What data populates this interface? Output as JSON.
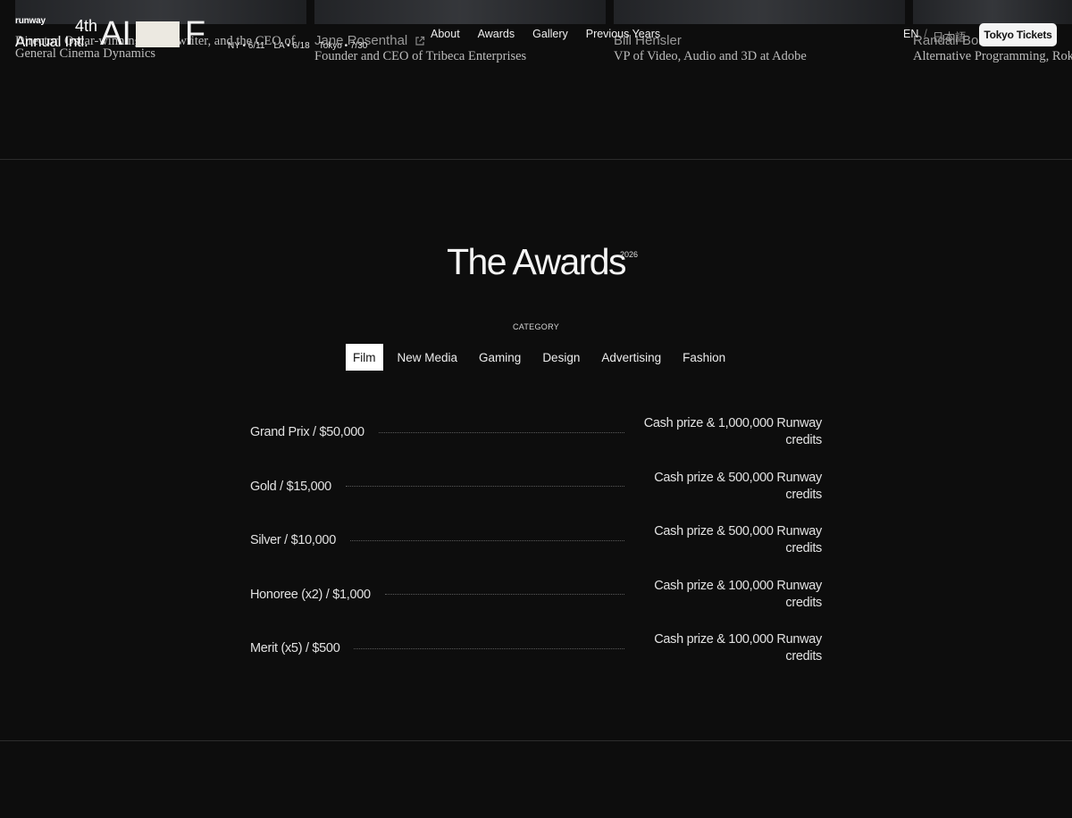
{
  "header": {
    "brand": "runway",
    "edition_line1": "4th",
    "edition_line2": "Annual Intl.",
    "logo": {
      "letters_left": "AI",
      "letters_right": "F"
    },
    "dates": [
      "NY • 6/11",
      "LA • 6/18",
      "Tokyo • 7/30"
    ],
    "nav": [
      "About",
      "Awards",
      "Gallery",
      "Previous Years"
    ],
    "lang": {
      "active": "EN",
      "separator": "/",
      "other": "日本語"
    },
    "cta_label": "Tokyo Tickets"
  },
  "judges": [
    {
      "name": "",
      "role": "Director, Oscar-winning screenwriter, and the CEO of General Cinema Dynamics"
    },
    {
      "name": "Jane Rosenthal",
      "role": "Founder and CEO of Tribeca Enterprises"
    },
    {
      "name": "Bill Hensler",
      "role": "VP of Video, Audio and 3D at Adobe"
    },
    {
      "name": "Randall Bob",
      "role": "Alternative Programming, Roku"
    }
  ],
  "awards": {
    "title": "The Awards",
    "year": "2026",
    "category_label": "CATEGORY",
    "tabs": [
      {
        "label": "Film",
        "active": true
      },
      {
        "label": "New Media",
        "active": false
      },
      {
        "label": "Gaming",
        "active": false
      },
      {
        "label": "Design",
        "active": false
      },
      {
        "label": "Advertising",
        "active": false
      },
      {
        "label": "Fashion",
        "active": false
      }
    ],
    "prizes": [
      {
        "name": "Grand Prix / $50,000",
        "reward": "Cash prize & 1,000,000 Runway credits"
      },
      {
        "name": "Gold / $15,000",
        "reward": "Cash prize & 500,000 Runway credits"
      },
      {
        "name": "Silver / $10,000",
        "reward": "Cash prize & 500,000 Runway credits"
      },
      {
        "name": "Honoree (x2) / $1,000",
        "reward": "Cash prize & 100,000 Runway credits"
      },
      {
        "name": "Merit (x5) / $500",
        "reward": "Cash prize & 100,000 Runway credits"
      }
    ]
  },
  "colors": {
    "background": "#0d0d0d",
    "text": "#eaeaea",
    "active_tab_bg": "#ffffff",
    "divider": "#2c2c2c"
  }
}
